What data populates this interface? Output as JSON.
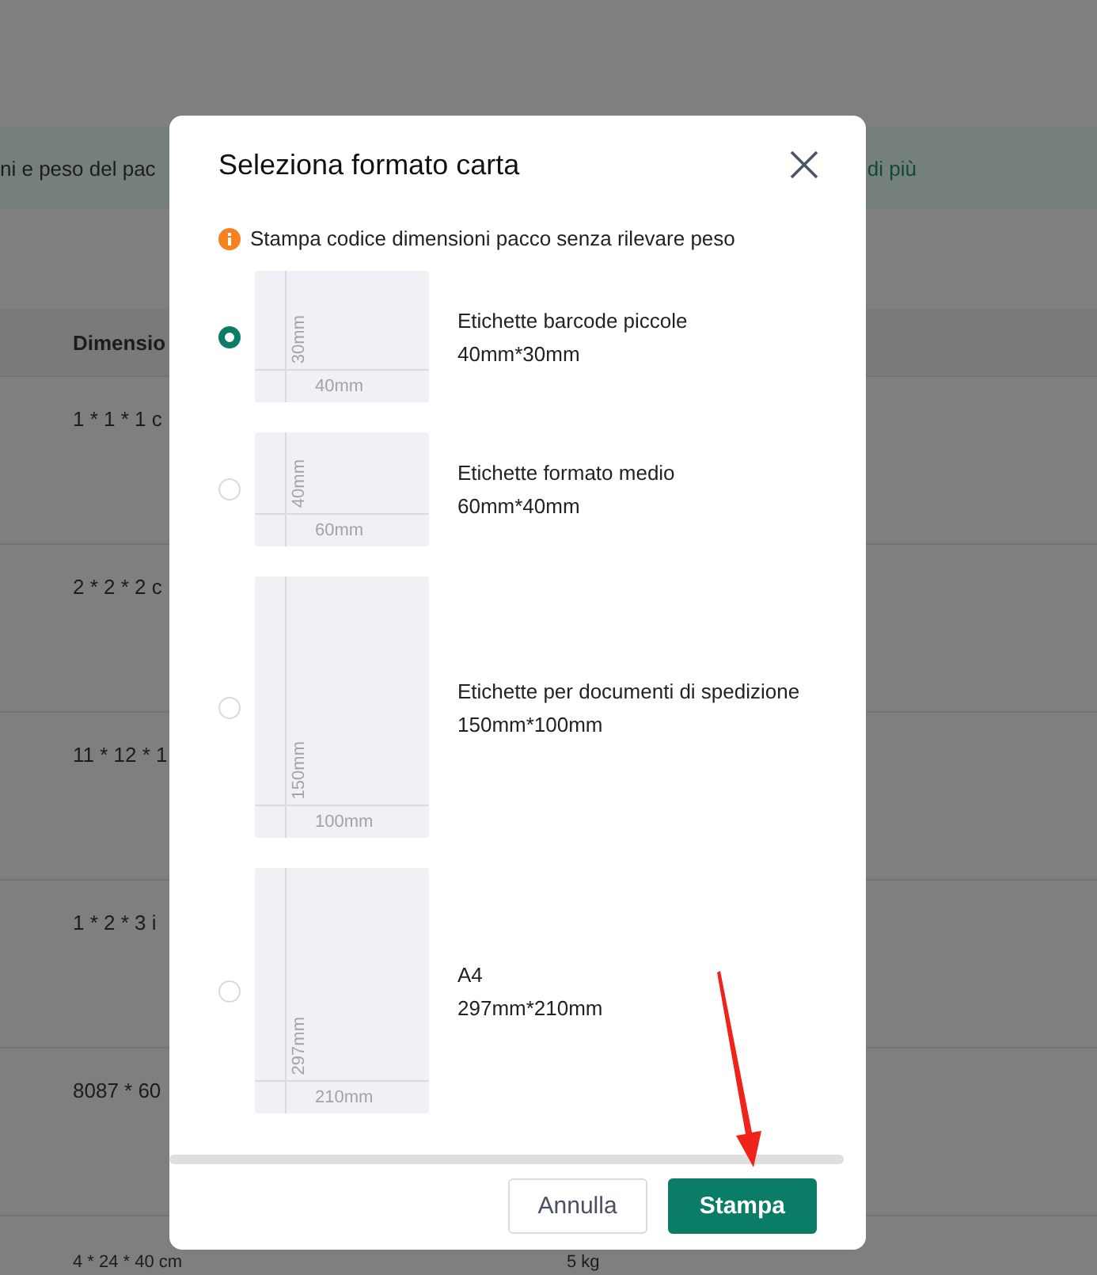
{
  "background": {
    "banner": {
      "text": "ni e peso del pac",
      "link": "di più"
    },
    "table": {
      "column_1": "Dimensio",
      "rows": [
        {
          "dimensions": "1 * 1 * 1 c"
        },
        {
          "dimensions": "2 * 2 * 2 c"
        },
        {
          "dimensions": "11 * 12 * 1"
        },
        {
          "dimensions": "1 * 2 * 3 i"
        },
        {
          "dimensions": "8087 * 60"
        },
        {
          "dimensions": "4 * 24 * 40 cm",
          "weight": "5 kg"
        }
      ]
    }
  },
  "dialog": {
    "title": "Seleziona formato carta",
    "notice": "Stampa codice dimensioni pacco senza rilevare peso",
    "options": [
      {
        "name": "Etichette barcode piccole",
        "size": "40mm*30mm",
        "width_label": "40mm",
        "height_label": "30mm",
        "selected": true
      },
      {
        "name": "Etichette formato medio",
        "size": "60mm*40mm",
        "width_label": "60mm",
        "height_label": "40mm",
        "selected": false
      },
      {
        "name": "Etichette per documenti di spedizione",
        "size": "150mm*100mm",
        "width_label": "100mm",
        "height_label": "150mm",
        "selected": false
      },
      {
        "name": "A4",
        "size": "297mm*210mm",
        "width_label": "210mm",
        "height_label": "297mm",
        "selected": false
      }
    ],
    "buttons": [
      {
        "label": "Annulla",
        "kind": "secondary"
      },
      {
        "label": "Stampa",
        "kind": "primary"
      }
    ]
  }
}
